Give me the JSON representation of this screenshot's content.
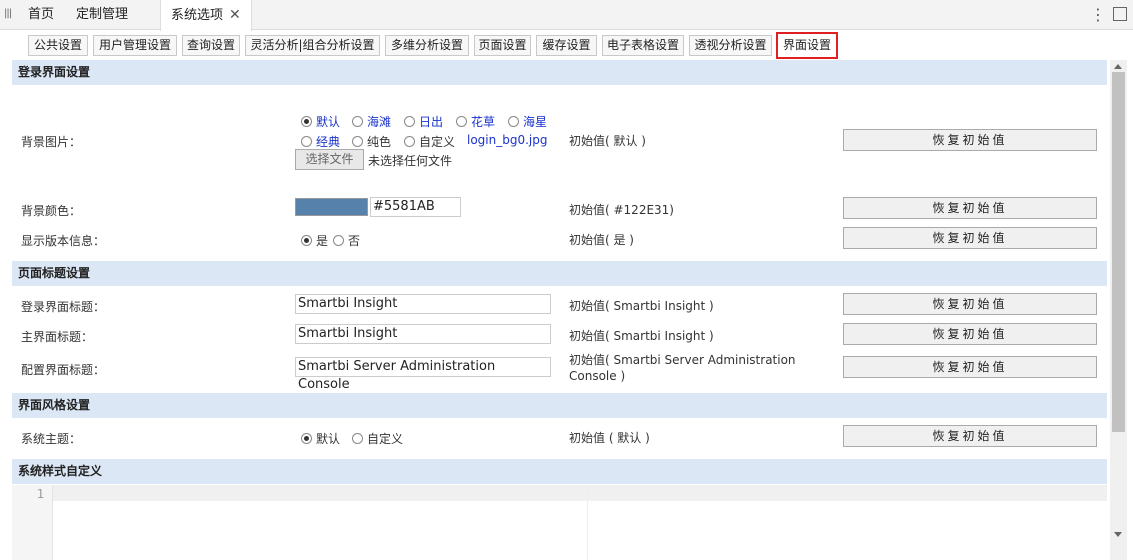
{
  "top_tabs": [
    {
      "label": "首页"
    },
    {
      "label": "定制管理"
    },
    {
      "label": "系统选项"
    }
  ],
  "sub_tabs": [
    {
      "label": "公共设置"
    },
    {
      "label": "用户管理设置"
    },
    {
      "label": "查询设置"
    },
    {
      "label": "灵活分析|组合分析设置"
    },
    {
      "label": "多维分析设置"
    },
    {
      "label": "页面设置"
    },
    {
      "label": "缓存设置"
    },
    {
      "label": "电子表格设置"
    },
    {
      "label": "透视分析设置"
    },
    {
      "label": "界面设置"
    }
  ],
  "active_sub_tab": "界面设置",
  "reset_label": "恢复初始值",
  "sections": {
    "login": {
      "title": "登录界面设置",
      "bg_image": {
        "label": "背景图片：",
        "options": [
          "默认",
          "海滩",
          "日出",
          "花草",
          "海星",
          "经典",
          "纯色",
          "自定义"
        ],
        "selected": "默认",
        "custom_file": "login_bg0.jpg",
        "file_button": "选择文件",
        "file_status": "未选择任何文件",
        "initial": "初始值( 默认 )"
      },
      "bg_color": {
        "label": "背景颜色：",
        "value": "#5581AB",
        "swatch": "#5581AB",
        "initial": "初始值( #122E31)"
      },
      "show_version": {
        "label": "显示版本信息：",
        "options": [
          "是",
          "否"
        ],
        "selected": "是",
        "initial": "初始值( 是 )"
      }
    },
    "page_title": {
      "title": "页面标题设置",
      "login_title": {
        "label": "登录界面标题：",
        "value": "Smartbi Insight",
        "initial": "初始值( Smartbi Insight )"
      },
      "main_title": {
        "label": "主界面标题：",
        "value": "Smartbi Insight",
        "initial": "初始值( Smartbi Insight )"
      },
      "config_title": {
        "label": "配置界面标题：",
        "value": "Smartbi Server Administration Console",
        "initial_line1": "初始值( Smartbi Server Administration",
        "initial_line2": "Console )"
      }
    },
    "style": {
      "title": "界面风格设置",
      "theme": {
        "label": "系统主题：",
        "options": [
          "默认",
          "自定义"
        ],
        "selected": "默认",
        "initial": "初始值 ( 默认 )"
      }
    },
    "custom_css": {
      "title": "系统样式自定义",
      "line_numbers": [
        "1"
      ]
    }
  }
}
